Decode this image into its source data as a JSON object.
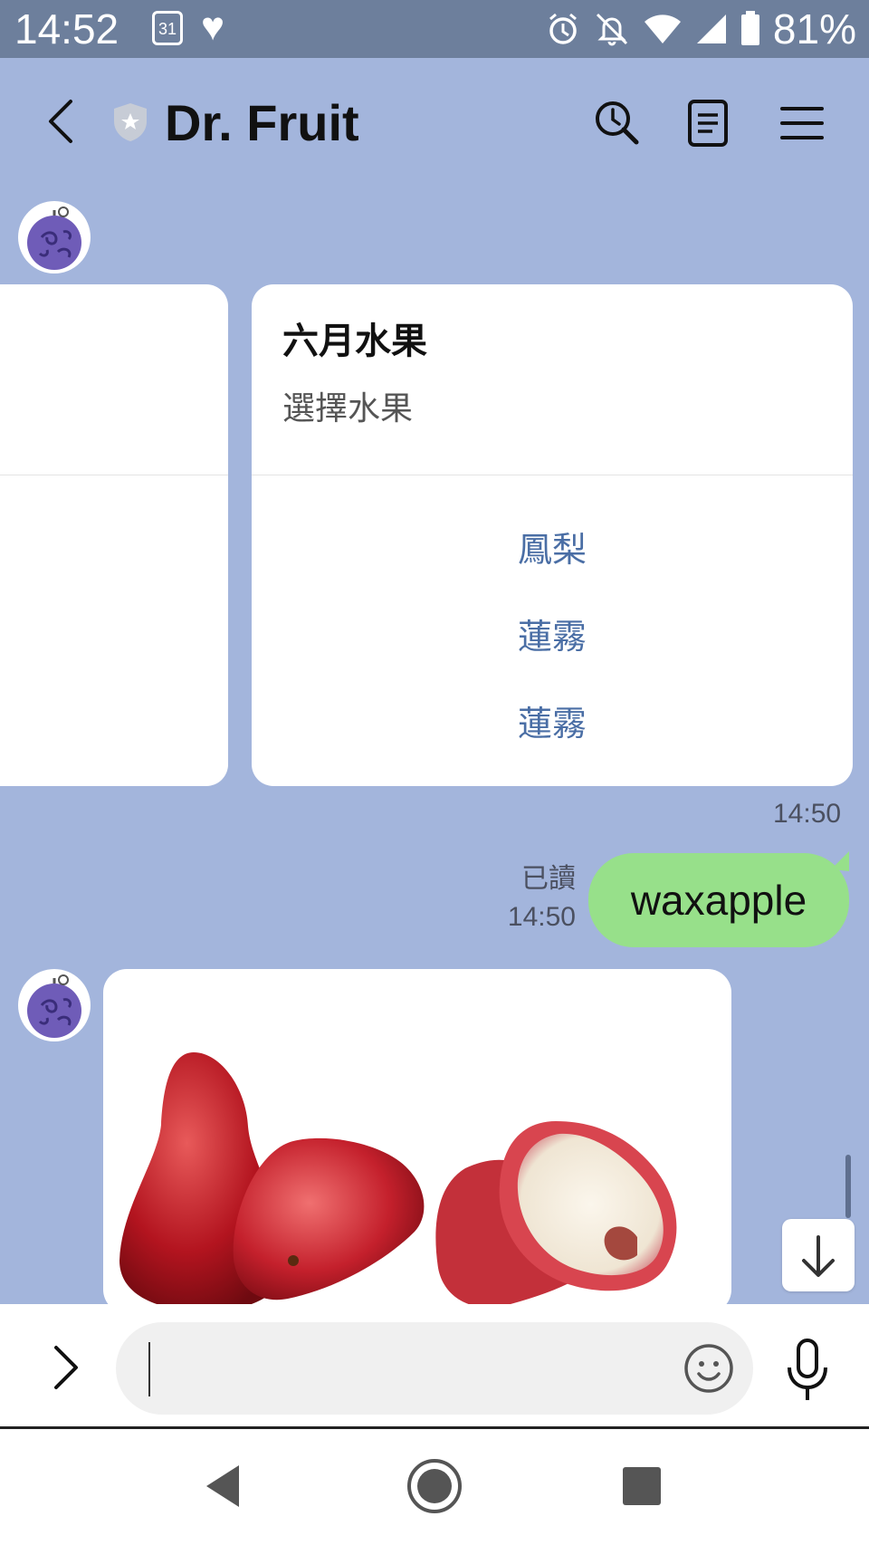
{
  "status_bar": {
    "time": "14:52",
    "calendar_day": "31",
    "battery_percent": "81%"
  },
  "header": {
    "title": "Dr. Fruit"
  },
  "messages": {
    "card": {
      "title": "六月水果",
      "subtitle": "選擇水果",
      "options": [
        "鳳梨",
        "蓮霧",
        "蓮霧"
      ]
    },
    "card_time": "14:50",
    "sent": {
      "read_label": "已讀",
      "time": "14:50",
      "text": "waxapple"
    }
  },
  "input": {
    "placeholder": ""
  },
  "colors": {
    "chat_background": "#a3b5dc",
    "status_bar": "#6d7f9c",
    "bubble_green": "#97e08a",
    "link_blue": "#4a6ea5"
  },
  "icons": [
    "back-icon",
    "shield-icon",
    "search-icon",
    "notes-icon",
    "menu-icon",
    "chevron-right-icon",
    "emoji-icon",
    "microphone-icon",
    "arrow-down-icon"
  ]
}
